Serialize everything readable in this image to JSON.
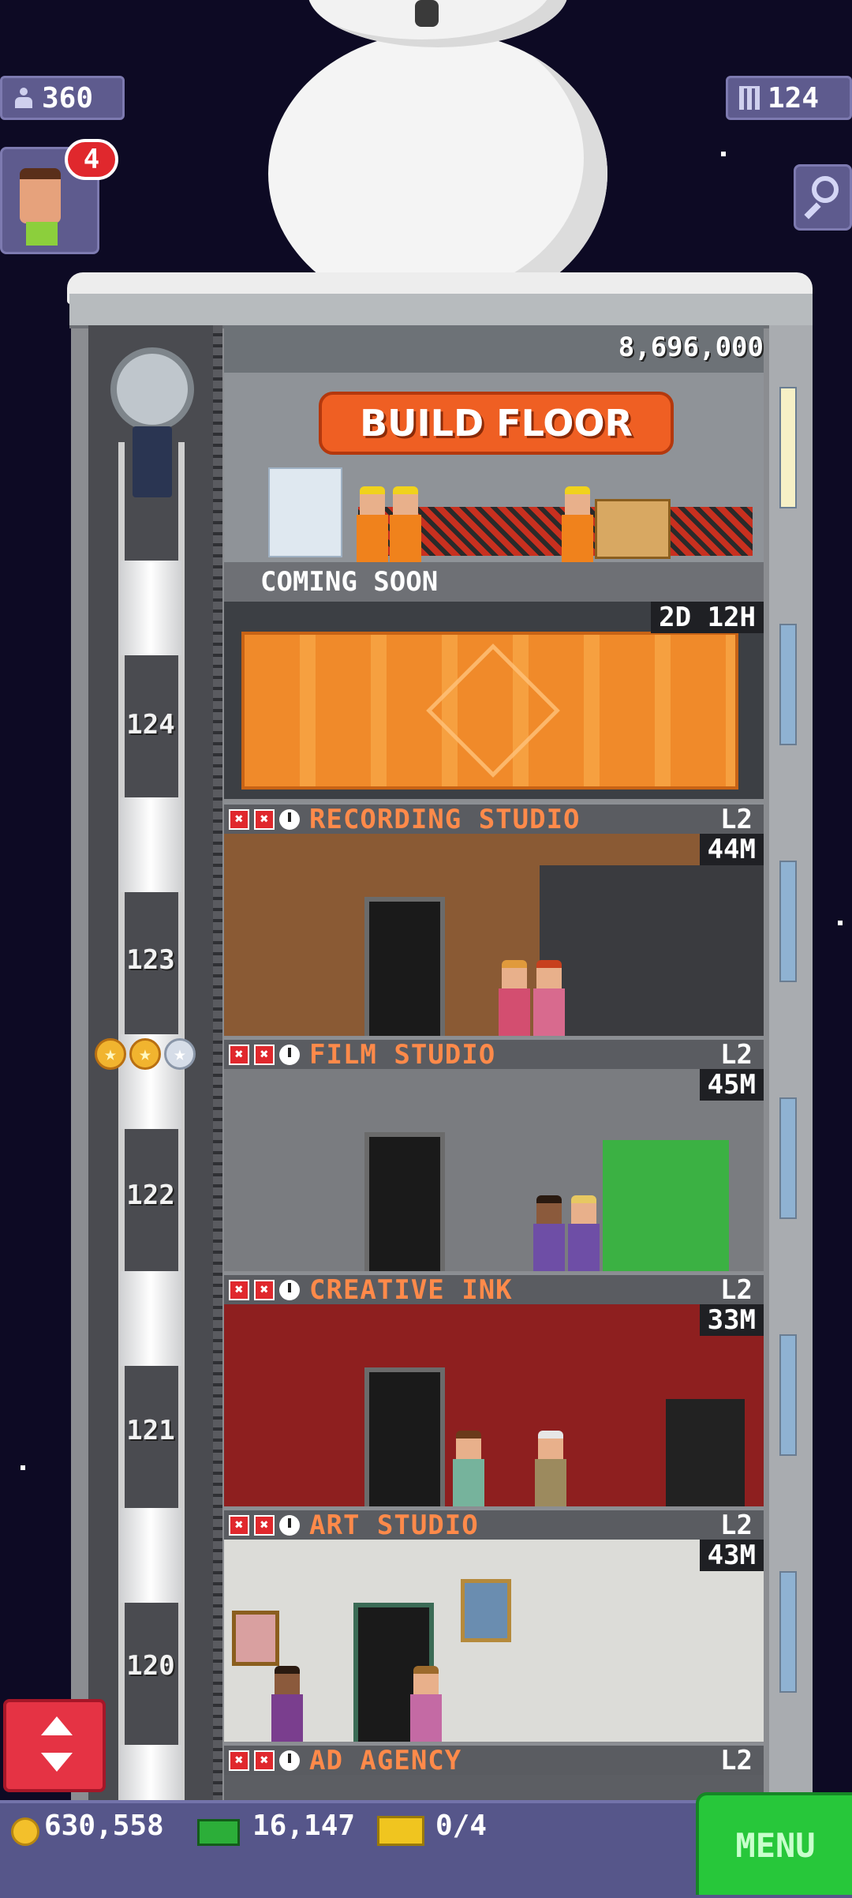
{
  "hud": {
    "population": "360",
    "floors": "124",
    "notification_count": "4"
  },
  "build_floor": {
    "sign": "BUILD FLOOR",
    "price": "8,696,000"
  },
  "coming_soon": {
    "label": "COMING SOON",
    "timer": "2D 12H"
  },
  "floors": [
    {
      "number": "124",
      "name": "RECORDING STUDIO",
      "level": "L2",
      "time": "44M",
      "wall": "#8a5a34"
    },
    {
      "number": "123",
      "name": "FILM STUDIO",
      "level": "L2",
      "time": "45M",
      "wall": "#7a7c80"
    },
    {
      "number": "122",
      "name": "CREATIVE INK",
      "level": "L2",
      "time": "33M",
      "wall": "#8e1f1f"
    },
    {
      "number": "121",
      "name": "ART STUDIO",
      "level": "L2",
      "time": "43M",
      "wall": "#dcdcd8"
    },
    {
      "number": "120",
      "name": "AD AGENCY",
      "level": "L2",
      "time": "",
      "wall": "#5c5e63"
    }
  ],
  "elevator_stars": {
    "gold": 2,
    "silver": 1
  },
  "bottom": {
    "coins": "630,558",
    "bux": "16,147",
    "tickets": "0/4",
    "menu_label": "MENU"
  },
  "colors": {
    "label_text": "#ff8a4a",
    "menu_green": "#27c73a",
    "sky": "#0d0a24"
  }
}
